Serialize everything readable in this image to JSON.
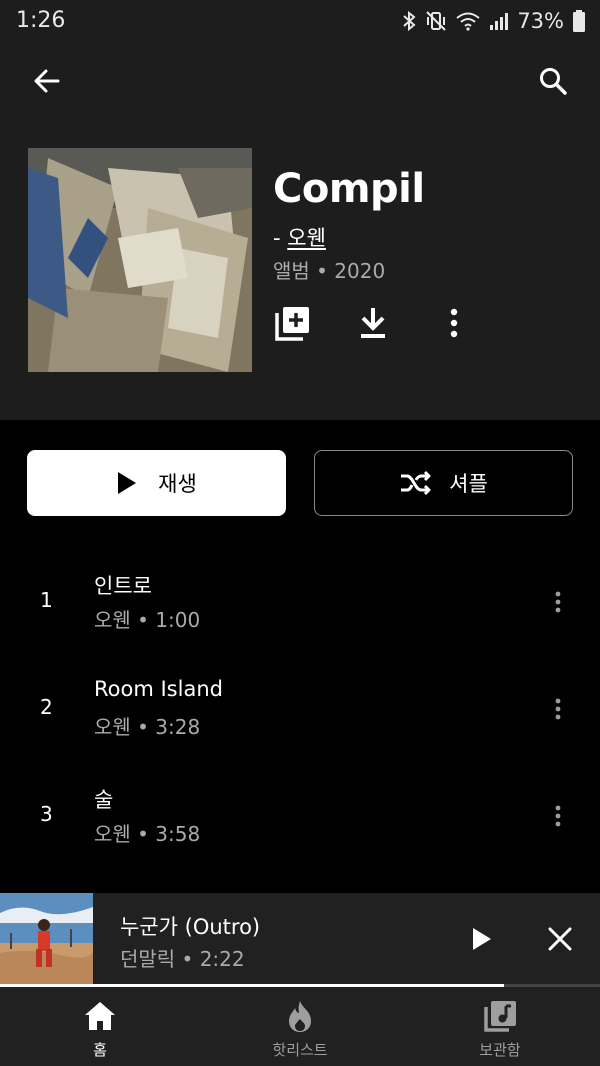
{
  "status_bar": {
    "time": "1:26",
    "battery": "73%"
  },
  "album": {
    "title": "Compil",
    "artist_prefix": "- ",
    "artist": "오웬",
    "meta": "앨범 • 2020"
  },
  "buttons": {
    "play_label": "재생",
    "shuffle_label": "셔플"
  },
  "tracks": [
    {
      "number": "1",
      "title": "인트로",
      "subtitle": "오웬 • 1:00"
    },
    {
      "number": "2",
      "title": "Room Island",
      "subtitle": "오웬 • 3:28"
    },
    {
      "number": "3",
      "title": "술",
      "subtitle": "오웬 • 3:58"
    }
  ],
  "mini_player": {
    "title": "누군가 (Outro)",
    "subtitle": "던말릭 • 2:22",
    "progress": 0.84
  },
  "nav": [
    {
      "label": "홈",
      "icon": "home-icon",
      "active": true
    },
    {
      "label": "핫리스트",
      "icon": "flame-icon",
      "active": false
    },
    {
      "label": "보관함",
      "icon": "library-icon",
      "active": false
    }
  ],
  "colors": {
    "active": "#ffffff",
    "inactive": "#9e9e9e",
    "header_bg": "#1d1d1d"
  }
}
